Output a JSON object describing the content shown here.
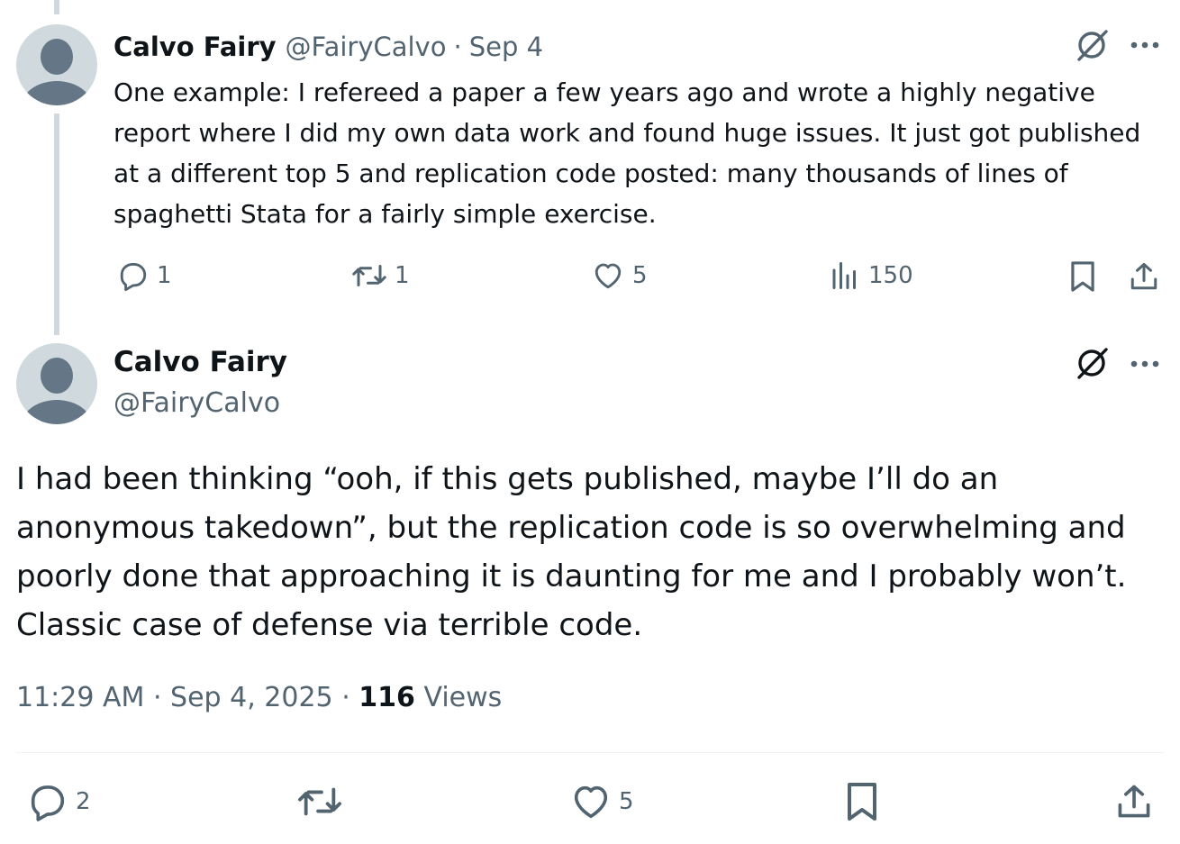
{
  "tweet1": {
    "author_name": "Calvo Fairy",
    "handle": "@FairyCalvo",
    "separator": "·",
    "date": "Sep 4",
    "text": "One example: I refereed a paper a few years ago and wrote a highly negative report where I did my own data work and found huge issues. It just got published  at a different top 5 and replication code posted: many thousands of lines of spaghetti Stata for a fairly simple exercise.",
    "replies": "1",
    "reposts": "1",
    "likes": "5",
    "views": "150"
  },
  "tweet2": {
    "author_name": "Calvo Fairy",
    "handle": "@FairyCalvo",
    "text": "I had been thinking “ooh, if this gets published, maybe I’ll do an anonymous takedown”, but the replication code is so overwhelming and poorly done that approaching it is daunting for me and I probably won’t. Classic case of defense via terrible code.",
    "time": "11:29 AM",
    "separator": "·",
    "date": "Sep 4, 2025",
    "views_count": "116",
    "views_label": "Views",
    "replies": "2",
    "likes": "5"
  },
  "icons": {
    "reply": "reply-icon",
    "repost": "repost-icon",
    "like": "heart-icon",
    "views": "analytics-icon",
    "bookmark": "bookmark-icon",
    "share": "share-icon",
    "grok": "grok-icon",
    "more": "more-icon"
  },
  "colors": {
    "text": "#0f1419",
    "muted": "#536471",
    "thread_line": "#cfd9de",
    "avatar_bg": "#cfd9de",
    "avatar_fg": "#657786"
  }
}
